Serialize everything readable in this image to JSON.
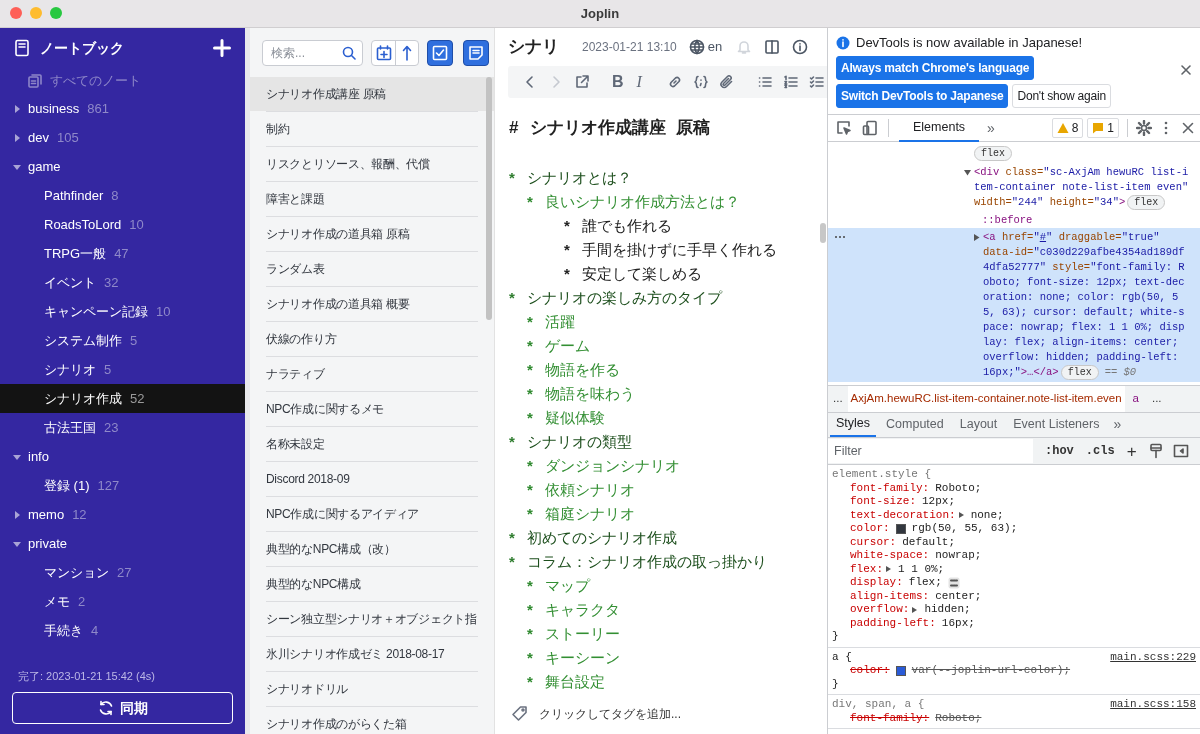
{
  "window": {
    "title": "Joplin"
  },
  "sidebar": {
    "title": "ノートブック",
    "all_notes": "すべてのノート",
    "notebooks": [
      {
        "name": "business",
        "count": "861",
        "expanded": false,
        "selected": false
      },
      {
        "name": "dev",
        "count": "105",
        "expanded": false,
        "selected": false
      },
      {
        "name": "game",
        "expanded": true,
        "selected": false,
        "children": [
          {
            "name": "Pathfinder",
            "count": "8",
            "selected": false
          },
          {
            "name": "RoadsToLord",
            "count": "10",
            "selected": false
          },
          {
            "name": "TRPG一般",
            "count": "47",
            "selected": false
          },
          {
            "name": "イベント",
            "count": "32",
            "selected": false
          },
          {
            "name": "キャンペーン記録",
            "count": "10",
            "selected": false
          },
          {
            "name": "システム制作",
            "count": "5",
            "selected": false
          },
          {
            "name": "シナリオ",
            "count": "5",
            "selected": false
          },
          {
            "name": "シナリオ作成",
            "count": "52",
            "selected": true
          },
          {
            "name": "古法王国",
            "count": "23",
            "selected": false
          }
        ]
      },
      {
        "name": "info",
        "expanded": true,
        "selected": false,
        "children": [
          {
            "name": "登録 (1)",
            "count": "127",
            "selected": false
          }
        ]
      },
      {
        "name": "memo",
        "count": "12",
        "expanded": false,
        "selected": false
      },
      {
        "name": "private",
        "expanded": true,
        "selected": false,
        "children": [
          {
            "name": "マンション",
            "count": "27",
            "selected": false
          },
          {
            "name": "メモ",
            "count": "2",
            "selected": false
          },
          {
            "name": "手続き",
            "count": "4",
            "selected": false
          }
        ]
      }
    ],
    "sync_status": "完了: 2023-01-21 15:42 (4s)",
    "sync_button": "同期"
  },
  "note_list": {
    "search_placeholder": "検索...",
    "notes": [
      {
        "title": "シナリオ作成講座 原稿",
        "selected": true
      },
      {
        "title": "制約",
        "selected": false
      },
      {
        "title": "リスクとリソース、報酬、代償",
        "selected": false
      },
      {
        "title": "障害と課題",
        "selected": false
      },
      {
        "title": "シナリオ作成の道具箱 原稿",
        "selected": false
      },
      {
        "title": "ランダム表",
        "selected": false
      },
      {
        "title": "シナリオ作成の道具箱 概要",
        "selected": false
      },
      {
        "title": "伏線の作り方",
        "selected": false
      },
      {
        "title": "ナラティブ",
        "selected": false
      },
      {
        "title": "NPC作成に関するメモ",
        "selected": false
      },
      {
        "title": "名称未設定",
        "selected": false
      },
      {
        "title": "Discord 2018-09",
        "selected": false
      },
      {
        "title": "NPC作成に関するアイディア",
        "selected": false
      },
      {
        "title": "典型的なNPC構成（改）",
        "selected": false
      },
      {
        "title": "典型的なNPC構成",
        "selected": false
      },
      {
        "title": "シーン独立型シナリオ＋オブジェクト指",
        "selected": false
      },
      {
        "title": "氷川シナリオ作成ゼミ 2018-08-17",
        "selected": false
      },
      {
        "title": "シナリオドリル",
        "selected": false
      },
      {
        "title": "シナリオ作成のがらくた箱",
        "selected": false
      }
    ]
  },
  "editor": {
    "title": "シナリ",
    "date": "2023-01-21 13:10",
    "language": "en",
    "toolbar": [
      {
        "kind": "back",
        "disabled": false
      },
      {
        "kind": "forward",
        "disabled": true
      },
      {
        "kind": "external",
        "disabled": false
      },
      {
        "kind": "bold",
        "label": "B",
        "disabled": false
      },
      {
        "kind": "italic",
        "label": "I",
        "disabled": false
      },
      {
        "kind": "link",
        "disabled": false
      },
      {
        "kind": "code",
        "disabled": false
      },
      {
        "kind": "attach",
        "disabled": false
      },
      {
        "kind": "bullets",
        "disabled": false
      },
      {
        "kind": "numbers",
        "disabled": false
      },
      {
        "kind": "checklist",
        "disabled": false
      }
    ],
    "heading_mark": "#",
    "heading": "シナリオ作成講座  原稿",
    "items": [
      {
        "bullet": "*",
        "text": "シナリオとは？",
        "children": [
          {
            "bullet": "*",
            "text": "良いシナリオ作成方法とは？",
            "children": [
              {
                "bullet": "*",
                "text": "誰でも作れる"
              },
              {
                "bullet": "*",
                "text": "手間を掛けずに手早く作れる"
              },
              {
                "bullet": "*",
                "text": "安定して楽しめる"
              }
            ]
          }
        ]
      },
      {
        "bullet": "*",
        "text": "シナリオの楽しみ方のタイプ",
        "children": [
          {
            "bullet": "*",
            "text": "活躍"
          },
          {
            "bullet": "*",
            "text": "ゲーム"
          },
          {
            "bullet": "*",
            "text": "物語を作る"
          },
          {
            "bullet": "*",
            "text": "物語を味わう"
          },
          {
            "bullet": "*",
            "text": "疑似体験"
          }
        ]
      },
      {
        "bullet": "*",
        "text": "シナリオの類型",
        "children": [
          {
            "bullet": "*",
            "text": "ダンジョンシナリオ"
          },
          {
            "bullet": "*",
            "text": "依頼シナリオ"
          },
          {
            "bullet": "*",
            "text": "箱庭シナリオ"
          }
        ]
      },
      {
        "bullet": "*",
        "text": "初めてのシナリオ作成"
      },
      {
        "bullet": "*",
        "text": "コラム：シナリオ作成の取っ掛かり",
        "children": [
          {
            "bullet": "*",
            "text": "マップ"
          },
          {
            "bullet": "*",
            "text": "キャラクタ"
          },
          {
            "bullet": "*",
            "text": "ストーリー"
          },
          {
            "bullet": "*",
            "text": "キーシーン"
          },
          {
            "bullet": "*",
            "text": "舞台設定"
          }
        ]
      }
    ],
    "tag_prompt": "クリックしてタグを追加..."
  },
  "devtools": {
    "infobar": {
      "message": "DevTools is now available in Japanese!",
      "buttons": [
        {
          "label": "Always match Chrome's language",
          "kind": "primary"
        },
        {
          "label": "Switch DevTools to Japanese",
          "kind": "primary"
        },
        {
          "label": "Don't show again",
          "kind": "secondary"
        }
      ]
    },
    "tabs": [
      {
        "label": "Elements",
        "selected": true
      }
    ],
    "more_tabs": "»",
    "warnings": "8",
    "issues": "1",
    "dom_tree": [
      {
        "kind": "tail",
        "badge": "flex"
      },
      {
        "kind": "element",
        "expanded": true,
        "selected": false,
        "badge": "flex",
        "lines": [
          [
            {
              "kind": "tag",
              "text": "<div"
            },
            {
              "kind": "attr",
              "text": " class="
            },
            {
              "kind": "value",
              "text": "\"sc-AxjAm hewuRC list-i"
            }
          ],
          [
            {
              "kind": "value",
              "text": "tem-container note-list-item even\""
            }
          ],
          [
            {
              "kind": "attr",
              "text": "width="
            },
            {
              "kind": "value",
              "text": "\"244\""
            },
            {
              "kind": "attr",
              "text": " height="
            },
            {
              "kind": "value",
              "text": "\"34\""
            },
            {
              "kind": "tag",
              "text": ">"
            }
          ]
        ],
        "children": [
          {
            "kind": "pseudo",
            "text": "::before"
          },
          {
            "kind": "element",
            "expanded": false,
            "selected": true,
            "badge": "flex",
            "suffix": "== $0",
            "lines": [
              [
                {
                  "kind": "tag",
                  "text": "<a"
                },
                {
                  "kind": "attr",
                  "text": " href="
                },
                {
                  "kind": "value",
                  "text": "\""
                },
                {
                  "kind": "link",
                  "text": "#"
                },
                {
                  "kind": "value",
                  "text": "\""
                },
                {
                  "kind": "attr",
                  "text": " draggable="
                },
                {
                  "kind": "value",
                  "text": "\"true\""
                }
              ],
              [
                {
                  "kind": "attr",
                  "text": "data-id="
                },
                {
                  "kind": "value",
                  "text": "\"c030d229afbe4354ad189df"
                }
              ],
              [
                {
                  "kind": "value",
                  "text": "4dfa52777\""
                },
                {
                  "kind": "attr",
                  "text": " style="
                },
                {
                  "kind": "value",
                  "text": "\"font-family: R"
                }
              ],
              [
                {
                  "kind": "value",
                  "text": "oboto; font-size: 12px; text-dec"
                }
              ],
              [
                {
                  "kind": "value",
                  "text": "oration: none; color: rgb(50, 5"
                }
              ],
              [
                {
                  "kind": "value",
                  "text": "5, 63); cursor: default; white-s"
                }
              ],
              [
                {
                  "kind": "value",
                  "text": "pace: nowrap; flex: 1 1 0%; disp"
                }
              ],
              [
                {
                  "kind": "value",
                  "text": "lay: flex; align-items: center;"
                }
              ],
              [
                {
                  "kind": "value",
                  "text": "overflow: hidden; padding-left:"
                }
              ],
              [
                {
                  "kind": "value",
                  "text": "16px;\""
                },
                {
                  "kind": "tag",
                  "text": ">…</a>"
                }
              ]
            ]
          }
        ]
      }
    ],
    "breadcrumbs": [
      {
        "kind": "ellipsis",
        "text": "..."
      },
      {
        "kind": "class",
        "text": "AxjAm.hewuRC.list-item-container.note-list-item.even"
      },
      {
        "kind": "tag",
        "text": "a"
      },
      {
        "kind": "ellipsis",
        "text": "..."
      }
    ],
    "styles_tabs": [
      {
        "label": "Styles",
        "selected": true
      },
      {
        "label": "Computed",
        "selected": false
      },
      {
        "label": "Layout",
        "selected": false
      },
      {
        "label": "Event Listeners",
        "selected": false
      }
    ],
    "styles_more": "»",
    "filter_placeholder": "Filter",
    "hov": ":hov",
    "cls": ".cls",
    "add": "+",
    "rules": [
      {
        "selector": "element.style {",
        "dimmed": true,
        "close": "}",
        "props": [
          {
            "name": "font-family:",
            "value": "Roboto;",
            "kind": "plain",
            "overridden": false
          },
          {
            "name": "font-size:",
            "value": "12px;",
            "kind": "plain",
            "overridden": false
          },
          {
            "name": "text-decoration:",
            "value": "none;",
            "kind": "expandable",
            "overridden": false
          },
          {
            "name": "color:",
            "value": "rgb(50, 55, 63);",
            "kind": "swatch",
            "color": "#32373f",
            "overridden": false
          },
          {
            "name": "cursor:",
            "value": "default;",
            "kind": "plain",
            "overridden": false
          },
          {
            "name": "white-space:",
            "value": "nowrap;",
            "kind": "plain",
            "overridden": false
          },
          {
            "name": "flex:",
            "value": "1 1 0%;",
            "kind": "expandable",
            "overridden": false
          },
          {
            "name": "display:",
            "value": "flex;",
            "kind": "flexbox",
            "overridden": false
          },
          {
            "name": "align-items:",
            "value": "center;",
            "kind": "plain",
            "overridden": false
          },
          {
            "name": "overflow:",
            "value": "hidden;",
            "kind": "expandable",
            "overridden": false
          },
          {
            "name": "padding-left:",
            "value": "16px;",
            "kind": "plain",
            "overridden": false
          }
        ]
      },
      {
        "selector": "a {",
        "source": "main.scss:229",
        "dimmed": false,
        "close": "}",
        "props": [
          {
            "name": "color:",
            "value": "var(--joplin-url-color);",
            "kind": "swatch",
            "color": "#2a5bd7",
            "overridden": true
          }
        ]
      },
      {
        "selector": "div, span, a {",
        "source": "main.scss:158",
        "dimmed": true,
        "props": [
          {
            "name": "font-family:",
            "value": "Roboto;",
            "kind": "plain",
            "overridden": true
          }
        ]
      }
    ]
  }
}
